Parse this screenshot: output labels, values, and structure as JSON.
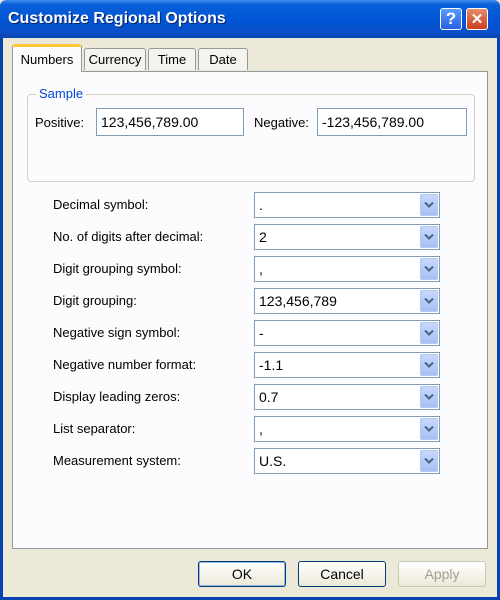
{
  "window": {
    "title": "Customize Regional Options"
  },
  "titlebar_icons": {
    "help": "?",
    "close": "✕"
  },
  "tabs": [
    {
      "label": "Numbers",
      "active": true
    },
    {
      "label": "Currency",
      "active": false
    },
    {
      "label": "Time",
      "active": false
    },
    {
      "label": "Date",
      "active": false
    }
  ],
  "sample": {
    "group_label": "Sample",
    "positive_label": "Positive:",
    "positive_value": "123,456,789.00",
    "negative_label": "Negative:",
    "negative_value": "-123,456,789.00"
  },
  "settings": [
    {
      "label": "Decimal symbol:",
      "value": "."
    },
    {
      "label": "No. of digits after decimal:",
      "value": "2"
    },
    {
      "label": "Digit grouping symbol:",
      "value": ","
    },
    {
      "label": "Digit grouping:",
      "value": "123,456,789"
    },
    {
      "label": "Negative sign symbol:",
      "value": "-"
    },
    {
      "label": "Negative number format:",
      "value": "-1.1"
    },
    {
      "label": "Display leading zeros:",
      "value": "0.7"
    },
    {
      "label": "List separator:",
      "value": ","
    },
    {
      "label": "Measurement system:",
      "value": "U.S."
    }
  ],
  "buttons": {
    "ok": "OK",
    "cancel": "Cancel",
    "apply": "Apply",
    "apply_enabled": false
  },
  "icons": {
    "dropdown": "chevron-down-icon"
  },
  "colors": {
    "titlebar": "#0056d6",
    "active_tab_accent": "#ffc73c",
    "group_label": "#0046d5",
    "dropdown_arrow": "#4d6185"
  }
}
